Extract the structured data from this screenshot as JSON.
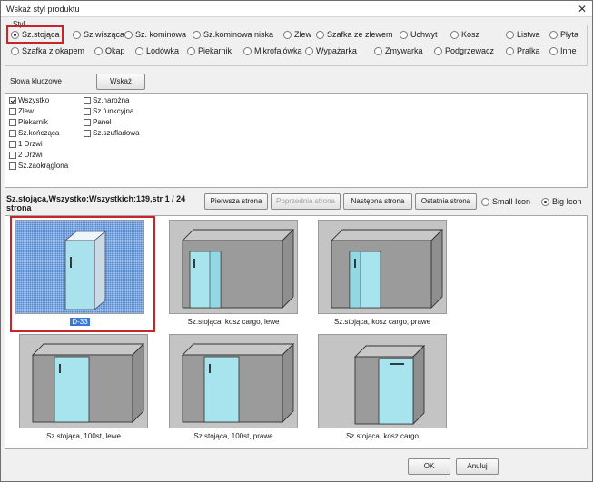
{
  "window": {
    "title": "Wskaż styl produktu",
    "close_glyph": "✕"
  },
  "styl": {
    "legend": "Styl",
    "row1": [
      "Sz.stojąca",
      "Sz.wisząca",
      "Sz. kominowa",
      "Sz.kominowa niska",
      "Zlew",
      "Szafka ze zlewem",
      "Uchwyt",
      "Kosz",
      "Listwa",
      "Płyta"
    ],
    "row2": [
      "Szafka z okapem",
      "Okap",
      "Lodówka",
      "Piekarnik",
      "Mikrofalówka",
      "Wypażarka",
      "Zmywarka",
      "Podgrzewacz",
      "Pralka",
      "Inne"
    ],
    "selected": "Sz.stojąca"
  },
  "keywords": {
    "label": "Słowa kluczowe",
    "show_button": "Wskaż",
    "col1": [
      {
        "label": "Wszystko",
        "checked": true
      },
      {
        "label": "Zlew",
        "checked": false
      },
      {
        "label": "Piekarnik",
        "checked": false
      },
      {
        "label": "Sz.kończąca",
        "checked": false
      },
      {
        "label": "1 Drzwi",
        "checked": false
      },
      {
        "label": "2 Drzwi",
        "checked": false
      },
      {
        "label": "Sz.zaokrąglona",
        "checked": false
      }
    ],
    "col2": [
      {
        "label": "Sz.narożna",
        "checked": false
      },
      {
        "label": "Sz.funkcyjna",
        "checked": false
      },
      {
        "label": "Panel",
        "checked": false
      },
      {
        "label": "Sz.szufladowa",
        "checked": false
      }
    ]
  },
  "pager": {
    "status": "Sz.stojąca,Wszystko:Wszystkich:139,str 1 / 24 strona",
    "first": "Pierwsza strona",
    "prev": "Poprzednia strona",
    "next": "Następna strona",
    "last": "Ostatnia strona",
    "small_icon": "Small Icon",
    "big_icon": "Big Icon",
    "view_mode": "Big Icon"
  },
  "items": [
    {
      "caption": "D-33",
      "selected": true,
      "icon": "base-cabinet-tall-icon"
    },
    {
      "caption": "Sz.stojąca, kosz cargo, lewe",
      "selected": false,
      "icon": "corner-cabinet-cargo-left-icon"
    },
    {
      "caption": "Sz.stojąca, kosz cargo, prawe",
      "selected": false,
      "icon": "corner-cabinet-cargo-right-icon"
    },
    {
      "caption": "Sz.stojąca, 100st, lewe",
      "selected": false,
      "icon": "corner-cabinet-100-left-icon"
    },
    {
      "caption": "Sz.stojąca, 100st, prawe",
      "selected": false,
      "icon": "corner-cabinet-100-right-icon"
    },
    {
      "caption": "Sz.stojąca, kosz cargo",
      "selected": false,
      "icon": "base-cabinet-cargo-icon"
    }
  ],
  "footer": {
    "ok": "OK",
    "cancel": "Anuluj"
  },
  "colors": {
    "highlight": "#c8242a",
    "door_fill": "#8edbe8",
    "selection": "#4b8be0"
  }
}
